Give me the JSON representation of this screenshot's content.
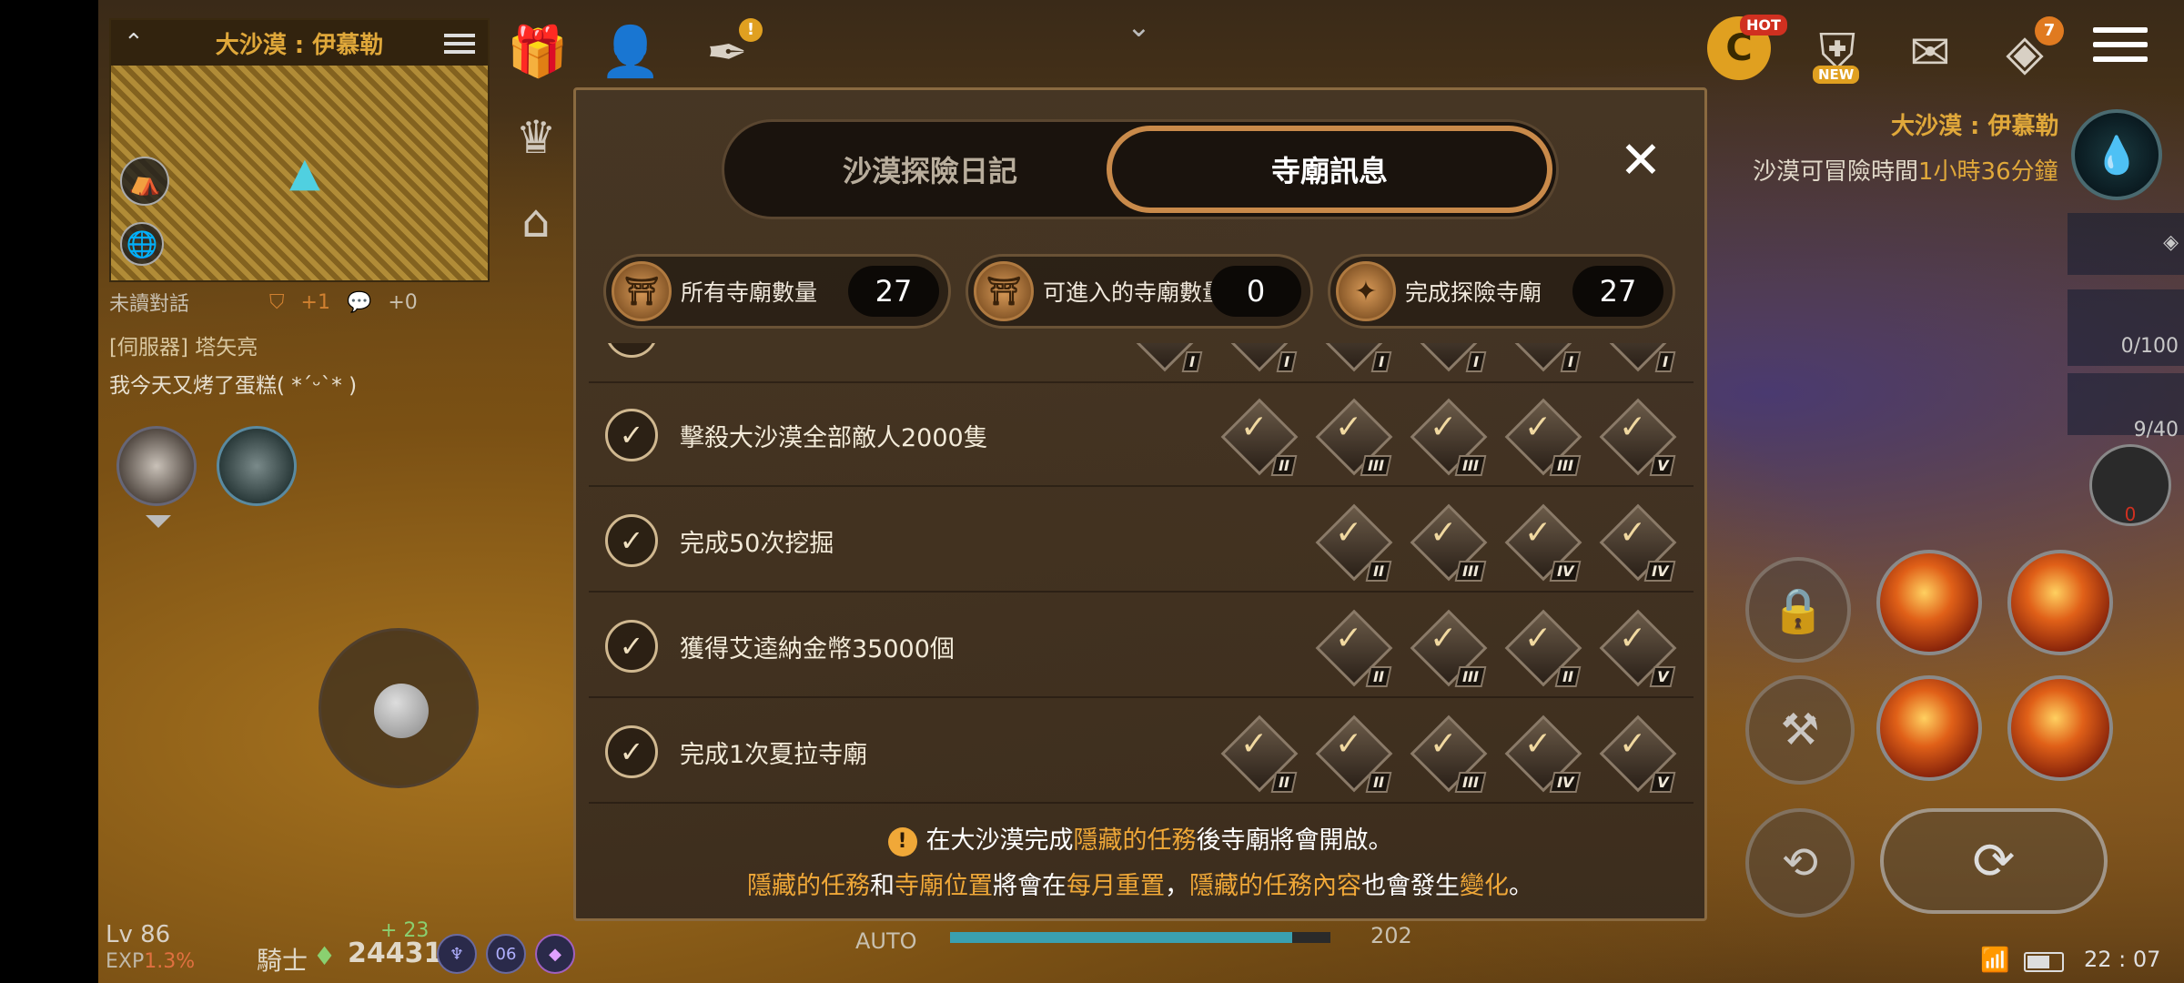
{
  "minimap": {
    "title": "大沙漠 : 伊慕勒",
    "collapse_icon": "chevron-up-icon",
    "list_icon": "list-icon"
  },
  "chat": {
    "unread": "未讀對話",
    "shield_count": "+1",
    "bubble_count": "+0",
    "server_tag": "[伺服器]",
    "sender": "塔矢亮",
    "message": "我今天又烤了蛋糕( *´ᵕ`* )"
  },
  "top": {
    "icons": [
      "gift-icon",
      "character-icon",
      "feather-icon"
    ],
    "right_icons": [
      "coin-icon",
      "upgrade-icon",
      "mailbox-icon",
      "quest-alert-icon",
      "menu-icon"
    ],
    "hot": "HOT",
    "new": "NEW",
    "quest_count": "7"
  },
  "status": {
    "zone": "大沙漠 : 伊慕勒",
    "adventure_time_prefix": "沙漠可冒險時間",
    "adventure_time_value": "1小時36分鐘",
    "trackers": [
      "0/100",
      "9/40"
    ],
    "slot_count": "0"
  },
  "panel": {
    "tabs": [
      {
        "label": "沙漠探險日記",
        "active": false
      },
      {
        "label": "寺廟訊息",
        "active": true
      }
    ],
    "close": "✕",
    "stats": [
      {
        "label": "所有寺廟數量",
        "value": "27",
        "icon": "temple-icon"
      },
      {
        "label": "可進入的寺廟數量",
        "value": "0",
        "icon": "temple-gate-icon"
      },
      {
        "label": "完成探險寺廟",
        "value": "27",
        "icon": "scroll-icon"
      }
    ],
    "rows": [
      {
        "text": "擊殺大沙漠全部敵人2000隻",
        "tiers": [
          "II",
          "III",
          "III",
          "III",
          "V"
        ]
      },
      {
        "text": "完成50次挖掘",
        "tiers": [
          "II",
          "III",
          "IV",
          "IV"
        ]
      },
      {
        "text": "獲得艾逵納金幣35000個",
        "tiers": [
          "II",
          "III",
          "II",
          "V"
        ]
      },
      {
        "text": "完成1次夏拉寺廟",
        "tiers": [
          "II",
          "II",
          "III",
          "IV",
          "V"
        ]
      }
    ],
    "top_partial_tiers": [
      "I",
      "I",
      "I",
      "I",
      "I",
      "I"
    ],
    "notice_line1": {
      "a": "在大沙漠完成",
      "b": "隱藏的任務",
      "c": "後寺廟將會開啟。"
    },
    "notice_line2": {
      "a": "隱藏的任務",
      "b": "和",
      "c": "寺廟位置",
      "d": "將會在",
      "e": "每月重置",
      "f": "，",
      "g": "隱藏的任務內容",
      "h": "也會發生",
      "i": "變化",
      "j": "。"
    }
  },
  "player": {
    "level": "Lv 86",
    "exp_label": "EXP",
    "exp_pct": "1.3%",
    "class": "騎士",
    "power": "24431",
    "power_delta": "+ 23",
    "status_icons": [
      "guild-icon",
      "06",
      "buff-icon"
    ],
    "auto": "AUTO",
    "exp_bar_label": "202",
    "exp_bar_progress": 0.9
  },
  "system": {
    "time": "22 : 07",
    "battery_level": 0.7
  }
}
